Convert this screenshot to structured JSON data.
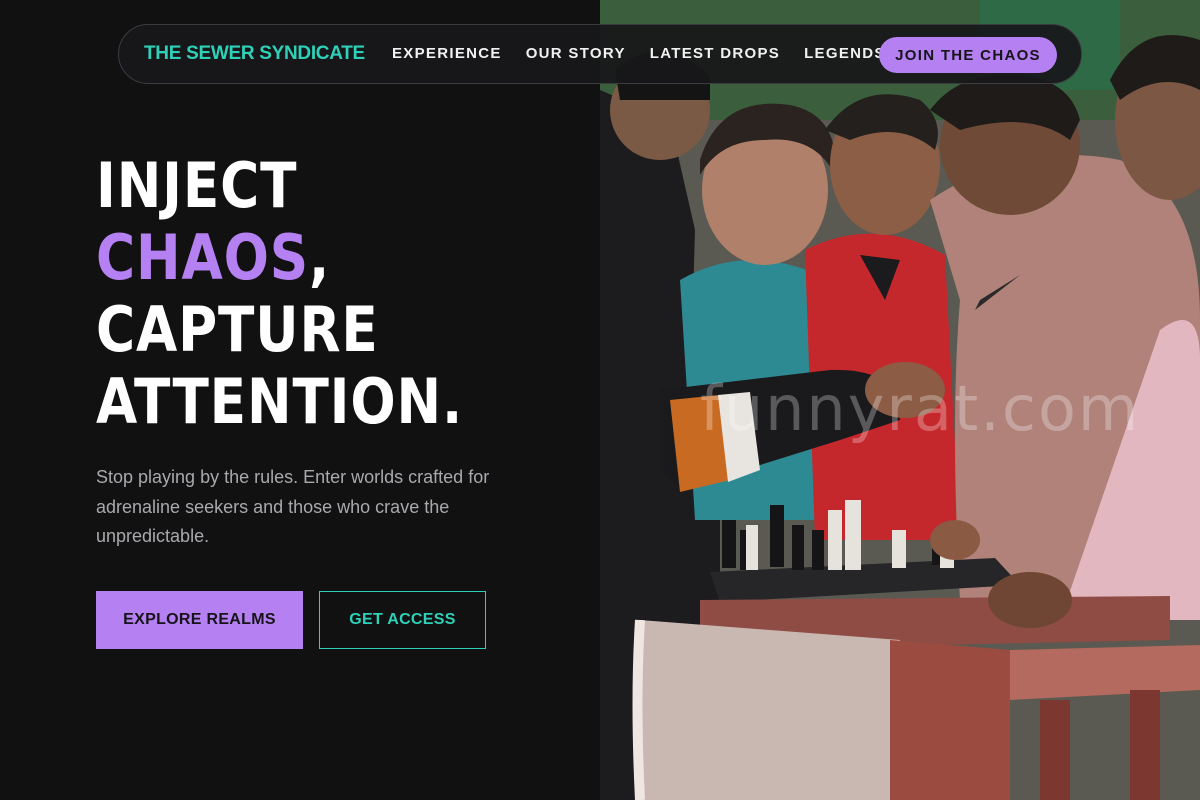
{
  "brand": {
    "name": "THE SEWER SYNDICATE"
  },
  "nav": {
    "links": [
      "EXPERIENCE",
      "OUR STORY",
      "LATEST DROPS",
      "LEGENDS"
    ],
    "cta": "JOIN THE CHAOS"
  },
  "hero": {
    "line1": "INJECT",
    "line2_accent": "CHAOS",
    "line2_suffix": ",",
    "line3": "CAPTURE",
    "line4": "ATTENTION.",
    "description": "Stop playing by the rules. Enter worlds crafted for adrenaline seekers and those who crave the unpredictable.",
    "primary_button": "EXPLORE REALMS",
    "secondary_button": "GET ACCESS"
  },
  "photo": {
    "watermark": "funnyrat.com"
  },
  "colors": {
    "background": "#121112",
    "brand_teal": "#2ed1b8",
    "accent_purple": "#b581f2",
    "text_white": "#ffffff",
    "text_muted": "#a9a8ad"
  }
}
